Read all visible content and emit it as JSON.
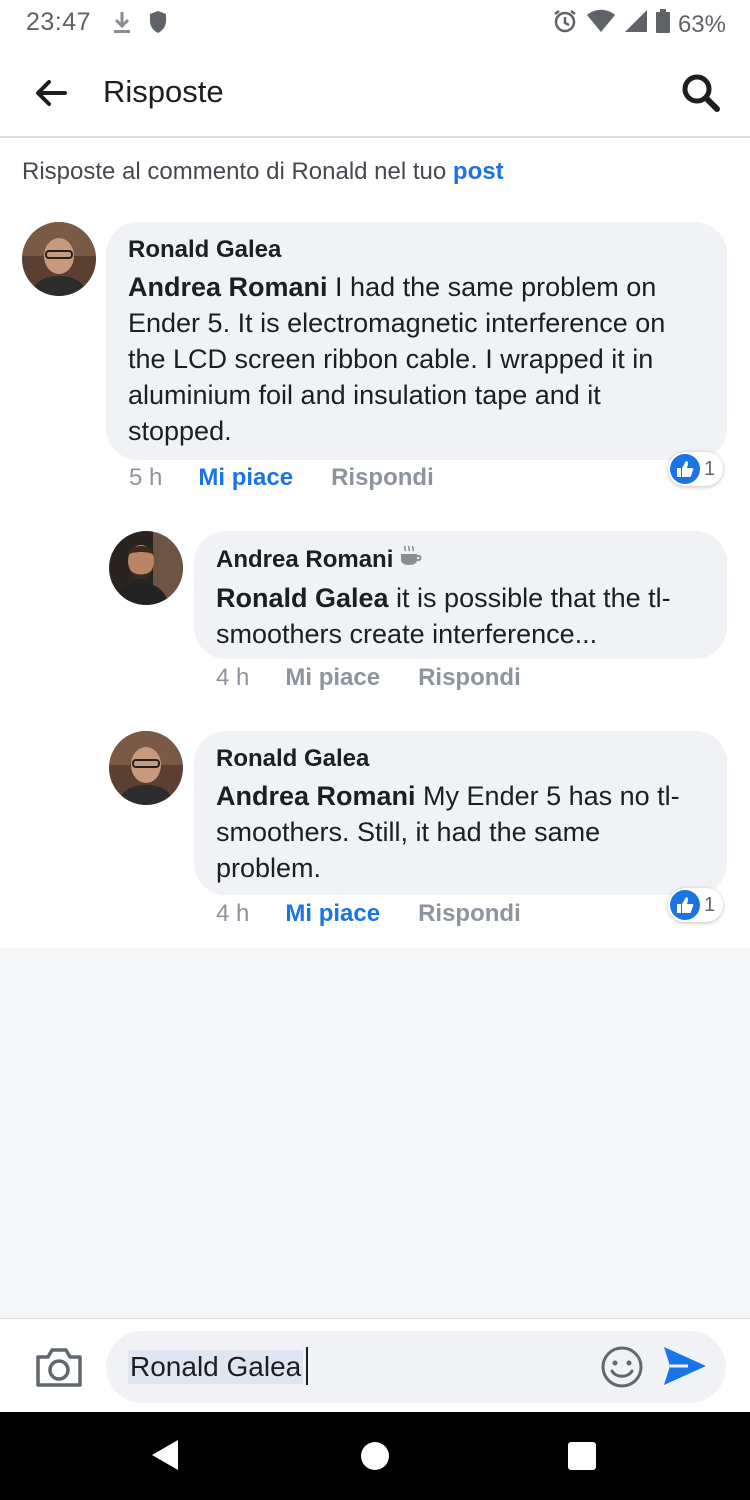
{
  "status_bar": {
    "time": "23:47",
    "battery": "63%"
  },
  "header": {
    "title": "Risposte"
  },
  "context": {
    "prefix": "Risposte al commento di Ronald nel tuo",
    "link": "post"
  },
  "comments": [
    {
      "author": "Ronald Galea",
      "mention": "Andrea Romani",
      "text": " I had the same problem on Ender 5. It is electromagnetic interference on the LCD screen ribbon cable. I wrapped it in aluminium foil and insulation tape and it stopped.",
      "time": "5 h",
      "like_label": "Mi piace",
      "liked": true,
      "reply_label": "Rispondi",
      "reaction_count": "1"
    },
    {
      "author": "Andrea Romani",
      "author_badge": "coffee-cup-icon",
      "mention": "Ronald Galea",
      "text": " it is possible that the tl-smoothers create interference...",
      "time": "4 h",
      "like_label": "Mi piace",
      "liked": false,
      "reply_label": "Rispondi"
    },
    {
      "author": "Ronald Galea",
      "mention": "Andrea Romani",
      "text": " My Ender 5 has no tl-smoothers. Still, it had the same problem.",
      "time": "4 h",
      "like_label": "Mi piace",
      "liked": true,
      "reply_label": "Rispondi",
      "reaction_count": "1"
    }
  ],
  "composer": {
    "value": "Ronald Galea"
  },
  "colors": {
    "accent": "#1b74e4",
    "bubble": "#f0f2f5",
    "muted": "#8d949e"
  }
}
